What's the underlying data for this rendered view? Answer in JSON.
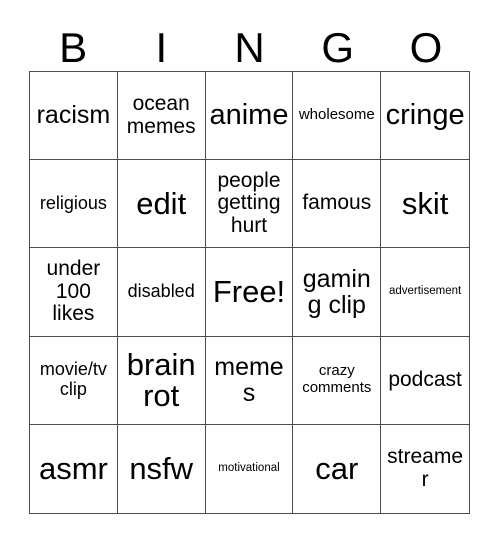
{
  "card": {
    "title": "Bingo Card",
    "background_color": "#ffffff",
    "text_color": "#000000",
    "border_color": "#4d4d4d"
  },
  "header": {
    "letters": [
      "B",
      "I",
      "N",
      "G",
      "O"
    ]
  },
  "grid": {
    "columns": 5,
    "rows": 5,
    "free_space": "Free!",
    "cells": [
      [
        {
          "label": "racism",
          "size": "lg"
        },
        {
          "label": "ocean memes",
          "size": "md"
        },
        {
          "label": "anime",
          "size": "xl"
        },
        {
          "label": "wholesome",
          "size": "xs"
        },
        {
          "label": "cringe",
          "size": "xl"
        }
      ],
      [
        {
          "label": "religious",
          "size": "sm"
        },
        {
          "label": "edit",
          "size": "xxl"
        },
        {
          "label": "people getting hurt",
          "size": "md"
        },
        {
          "label": "famous",
          "size": "md"
        },
        {
          "label": "skit",
          "size": "xxl"
        }
      ],
      [
        {
          "label": "under 100 likes",
          "size": "md"
        },
        {
          "label": "disabled",
          "size": "sm"
        },
        {
          "label": "Free!",
          "size": "xxl"
        },
        {
          "label": "gaming clip",
          "size": "lg"
        },
        {
          "label": "advertisement",
          "size": "xxs"
        }
      ],
      [
        {
          "label": "movie/tv clip",
          "size": "sm"
        },
        {
          "label": "brain rot",
          "size": "xxl"
        },
        {
          "label": "memes",
          "size": "lg"
        },
        {
          "label": "crazy comments",
          "size": "xs"
        },
        {
          "label": "podcast",
          "size": "md"
        }
      ],
      [
        {
          "label": "asmr",
          "size": "xxl"
        },
        {
          "label": "nsfw",
          "size": "xxl"
        },
        {
          "label": "motivational",
          "size": "xxs"
        },
        {
          "label": "car",
          "size": "xxl"
        },
        {
          "label": "streamer",
          "size": "md"
        }
      ]
    ]
  }
}
